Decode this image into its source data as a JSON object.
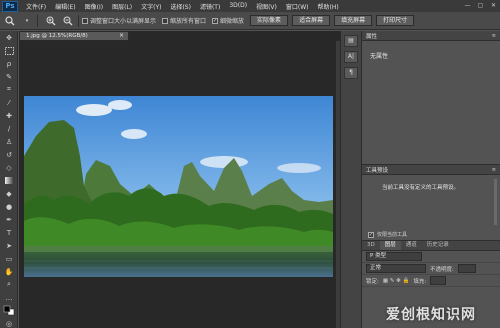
{
  "app": {
    "logo": "Ps"
  },
  "menu": [
    "文件(F)",
    "编辑(E)",
    "图像(I)",
    "图层(L)",
    "文字(Y)",
    "选择(S)",
    "滤镜(T)",
    "3D(D)",
    "视图(V)",
    "窗口(W)",
    "帮助(H)"
  ],
  "window_controls": [
    "—",
    "▢",
    "✕"
  ],
  "options": {
    "checkbox1": "调整窗口大小以满屏显示",
    "checkbox2": "缩放所有窗口",
    "checkbox3": "细微缩放",
    "checkbox3_checked": true,
    "btn_actual": "实际像素",
    "btn_fit": "适合屏幕",
    "btn_fill": "填充屏幕",
    "btn_print": "打印尺寸"
  },
  "document": {
    "tab_title": "1.jpg @ 12.5%(RGB/8)",
    "close": "×"
  },
  "tools": [
    "move-icon",
    "marquee-icon",
    "lasso-icon",
    "quick-select-icon",
    "crop-icon",
    "eyedropper-icon",
    "healing-icon",
    "brush-icon",
    "stamp-icon",
    "history-brush-icon",
    "eraser-icon",
    "gradient-icon",
    "blur-icon",
    "dodge-icon",
    "pen-icon",
    "type-icon",
    "path-select-icon",
    "shape-icon",
    "hand-icon",
    "zoom-icon",
    "more-icon",
    "color-swatch-icon",
    "quickmask-icon",
    "screen-mode-icon"
  ],
  "properties": {
    "title": "属性",
    "no_props": "无属性"
  },
  "tool_presets": {
    "title": "工具预设",
    "empty_text": "当前工具没有定义的工具预设。",
    "current_only": "仅限当前工具"
  },
  "layers": {
    "tabs": [
      "3D",
      "图层",
      "通道",
      "历史记录"
    ],
    "active_tab_index": 1,
    "kind_label": "P 类型",
    "blend_mode": "正常",
    "opacity_label": "不透明度:",
    "lock_label": "锁定:",
    "fill_label": "填充:"
  },
  "watermark": "爱创根知识网"
}
